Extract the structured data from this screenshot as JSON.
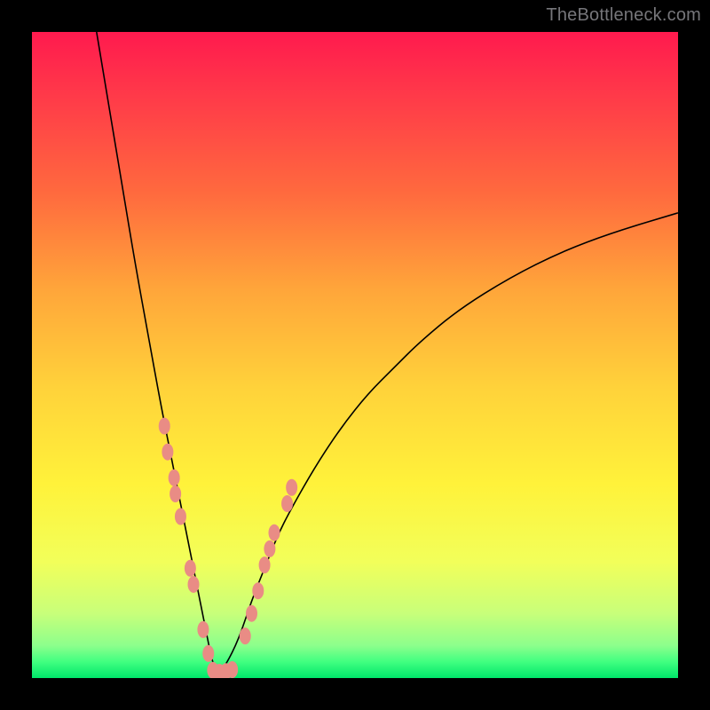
{
  "watermark": {
    "text": "TheBottleneck.com"
  },
  "colors": {
    "gradient_stops": [
      {
        "offset": 0.0,
        "color": "#ff1a4e"
      },
      {
        "offset": 0.1,
        "color": "#ff3a49"
      },
      {
        "offset": 0.25,
        "color": "#ff6a3e"
      },
      {
        "offset": 0.4,
        "color": "#ffa63a"
      },
      {
        "offset": 0.55,
        "color": "#ffd23a"
      },
      {
        "offset": 0.7,
        "color": "#fff23a"
      },
      {
        "offset": 0.82,
        "color": "#f2ff5a"
      },
      {
        "offset": 0.9,
        "color": "#c8ff7a"
      },
      {
        "offset": 0.95,
        "color": "#8cff8c"
      },
      {
        "offset": 0.975,
        "color": "#40ff80"
      },
      {
        "offset": 1.0,
        "color": "#00e66a"
      }
    ],
    "dot": "#e98c85",
    "curve": "#000000",
    "frame": "#000000"
  },
  "chart_data": {
    "type": "line",
    "title": "",
    "xlabel": "",
    "ylabel": "",
    "xlim": [
      0,
      100
    ],
    "ylim": [
      0,
      100
    ],
    "grid": false,
    "legend": false,
    "curve_note": "V-shaped curve: steep fall from top-left edge down to near-zero at minimum ≈ x=28, then concave-increasing rise toward ~72 at right edge.",
    "series": [
      {
        "name": "curve",
        "x": [
          10,
          12,
          14,
          16,
          18,
          20,
          22,
          24,
          26,
          27,
          28,
          29,
          30,
          32,
          34,
          36,
          38,
          40,
          44,
          48,
          52,
          56,
          60,
          66,
          74,
          82,
          90,
          100
        ],
        "y": [
          100,
          88,
          76,
          64,
          53,
          42,
          32,
          22,
          12,
          7,
          2,
          1,
          2,
          6,
          12,
          17,
          22,
          26,
          33,
          39,
          44,
          48,
          52,
          57,
          62,
          66,
          69,
          72
        ]
      }
    ],
    "markers": {
      "name": "salmon-dots",
      "note": "Clusters of salmon-colored oval markers on both sides of the curve near the valley",
      "points": [
        {
          "x": 20.5,
          "y": 39
        },
        {
          "x": 21.0,
          "y": 35
        },
        {
          "x": 22.0,
          "y": 31
        },
        {
          "x": 22.2,
          "y": 28.5
        },
        {
          "x": 23.0,
          "y": 25
        },
        {
          "x": 24.5,
          "y": 17
        },
        {
          "x": 25.0,
          "y": 14.5
        },
        {
          "x": 26.5,
          "y": 7.5
        },
        {
          "x": 27.3,
          "y": 3.8
        },
        {
          "x": 28.0,
          "y": 1.2
        },
        {
          "x": 29.0,
          "y": 0.9
        },
        {
          "x": 30.0,
          "y": 1.0
        },
        {
          "x": 31.0,
          "y": 1.3
        },
        {
          "x": 33.0,
          "y": 6.5
        },
        {
          "x": 34.0,
          "y": 10.0
        },
        {
          "x": 35.0,
          "y": 13.5
        },
        {
          "x": 36.0,
          "y": 17.5
        },
        {
          "x": 36.8,
          "y": 20.0
        },
        {
          "x": 37.5,
          "y": 22.5
        },
        {
          "x": 39.5,
          "y": 27.0
        },
        {
          "x": 40.2,
          "y": 29.5
        }
      ]
    }
  }
}
